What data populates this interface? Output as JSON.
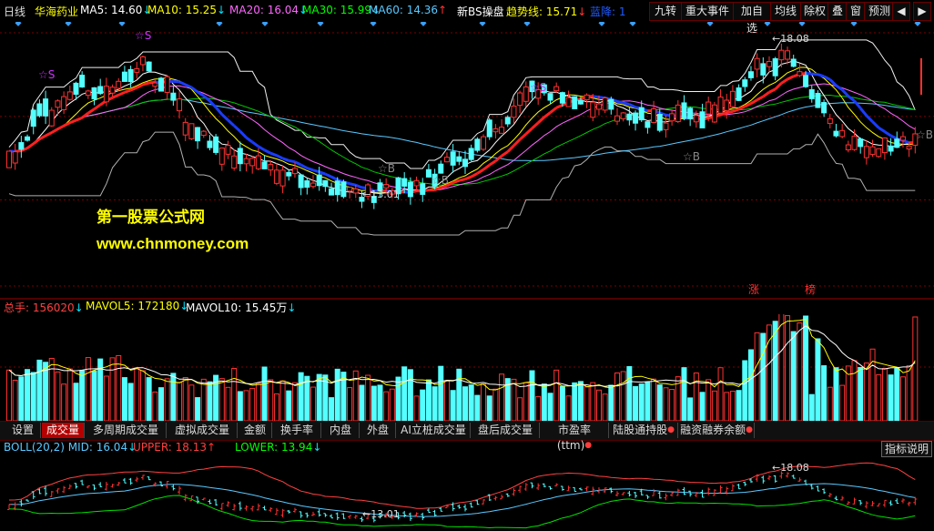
{
  "header": {
    "period": "日线",
    "stock_name": "华海药业",
    "indicators": [
      {
        "label": "MA5:",
        "value": "14.60",
        "arrow": "↓",
        "color": "#ffffff"
      },
      {
        "label": "MA10:",
        "value": "15.25",
        "arrow": "↓",
        "color": "#ffff00"
      },
      {
        "label": "MA20:",
        "value": "16.04",
        "arrow": "↓",
        "color": "#ff66ff"
      },
      {
        "label": "MA30:",
        "value": "15.99",
        "arrow": "↓",
        "color": "#00ff00"
      },
      {
        "label": "MA60:",
        "value": "14.36",
        "arrow": "↑",
        "color": "#59c8ff"
      }
    ],
    "formula": {
      "label": "新BS操盘",
      "color": "#ffffff"
    },
    "trend": {
      "label": "趋势线:",
      "value": "15.71",
      "arrow": "↓",
      "color": "#ffff00"
    },
    "blue_label": {
      "label": "蓝降:",
      "value": "1",
      "color": "#1e5bff"
    },
    "buttons": [
      "九转",
      "重大事件",
      "加自选",
      "均线",
      "除权",
      "叠",
      "窗",
      "预测"
    ],
    "nav_icons": [
      "prev-icon",
      "next-icon"
    ]
  },
  "main_chart": {
    "price_high_label": "18.08",
    "price_low_label": "13.01",
    "signals": [
      "S",
      "S",
      "S",
      "B",
      "B",
      "B",
      "B"
    ],
    "markers": [
      "涨",
      "榜"
    ]
  },
  "watermark": {
    "title": "第一股票公式网",
    "url": "www.chnmoney.com"
  },
  "volume": {
    "items": [
      {
        "label": "总手:",
        "value": "156020",
        "arrow": "↓",
        "color": "#ff4040"
      },
      {
        "label": "MAVOL5:",
        "value": "172180",
        "arrow": "↓",
        "color": "#ffff00"
      },
      {
        "label": "MAVOL10:",
        "value": "15.45万",
        "arrow": "↓",
        "color": "#ffffff"
      }
    ]
  },
  "tabs": [
    {
      "label": "设置",
      "dot": false,
      "active": false
    },
    {
      "label": "成交量",
      "dot": false,
      "active": true
    },
    {
      "label": "多周期成交量",
      "dot": false,
      "active": false
    },
    {
      "label": "虚拟成交量",
      "dot": false,
      "active": false
    },
    {
      "label": "金额",
      "dot": false,
      "active": false
    },
    {
      "label": "换手率",
      "dot": false,
      "active": false
    },
    {
      "label": "内盘",
      "dot": false,
      "active": false
    },
    {
      "label": "外盘",
      "dot": false,
      "active": false
    },
    {
      "label": "AI立桩成交量",
      "dot": false,
      "active": false
    },
    {
      "label": "盘后成交量",
      "dot": false,
      "active": false
    },
    {
      "label": "市盈率(ttm)",
      "dot": true,
      "active": false
    },
    {
      "label": "陆股通持股",
      "dot": true,
      "active": false
    },
    {
      "label": "融资融券余额",
      "dot": true,
      "active": false
    }
  ],
  "boll": {
    "items": [
      {
        "label": "BOLL(20,2) MID:",
        "value": "16.04",
        "arrow": "↓",
        "color": "#59c8ff"
      },
      {
        "label": "UPPER:",
        "value": "18.13",
        "arrow": "↑",
        "color": "#ff4040"
      },
      {
        "label": "LOWER:",
        "value": "13.94",
        "arrow": "↓",
        "color": "#00ff00"
      }
    ],
    "help_label": "指标说明",
    "high_label": "18.08",
    "low_label": "13.01"
  },
  "colors": {
    "up": "#ff3232",
    "down": "#54ffff",
    "red_line": "#ff2020",
    "blue_line": "#1a3cff",
    "grid": "#7a0000"
  }
}
